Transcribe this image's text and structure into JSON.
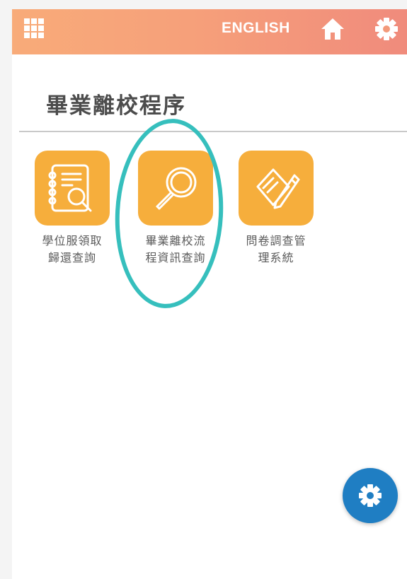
{
  "header": {
    "language_label": "ENGLISH",
    "menu_icon": "apps-grid-icon",
    "home_icon": "home-icon",
    "settings_icon": "gear-icon",
    "background": "#f6a07a"
  },
  "page": {
    "title": "畢業離校程序"
  },
  "apps": [
    {
      "label": "學位服領取\n歸還查詢",
      "icon": "notebook-search-icon"
    },
    {
      "label": "畢業離校流\n程資訊查詢",
      "icon": "magnifier-icon",
      "highlighted": true
    },
    {
      "label": "問卷調查管\n理系統",
      "icon": "paper-pen-icon"
    }
  ],
  "fab": {
    "icon": "gear-icon"
  },
  "colors": {
    "tile": "#f6ae3c",
    "ring": "#36bfbd",
    "fab": "#1f7ec3",
    "title_text": "#4c4c4c"
  }
}
